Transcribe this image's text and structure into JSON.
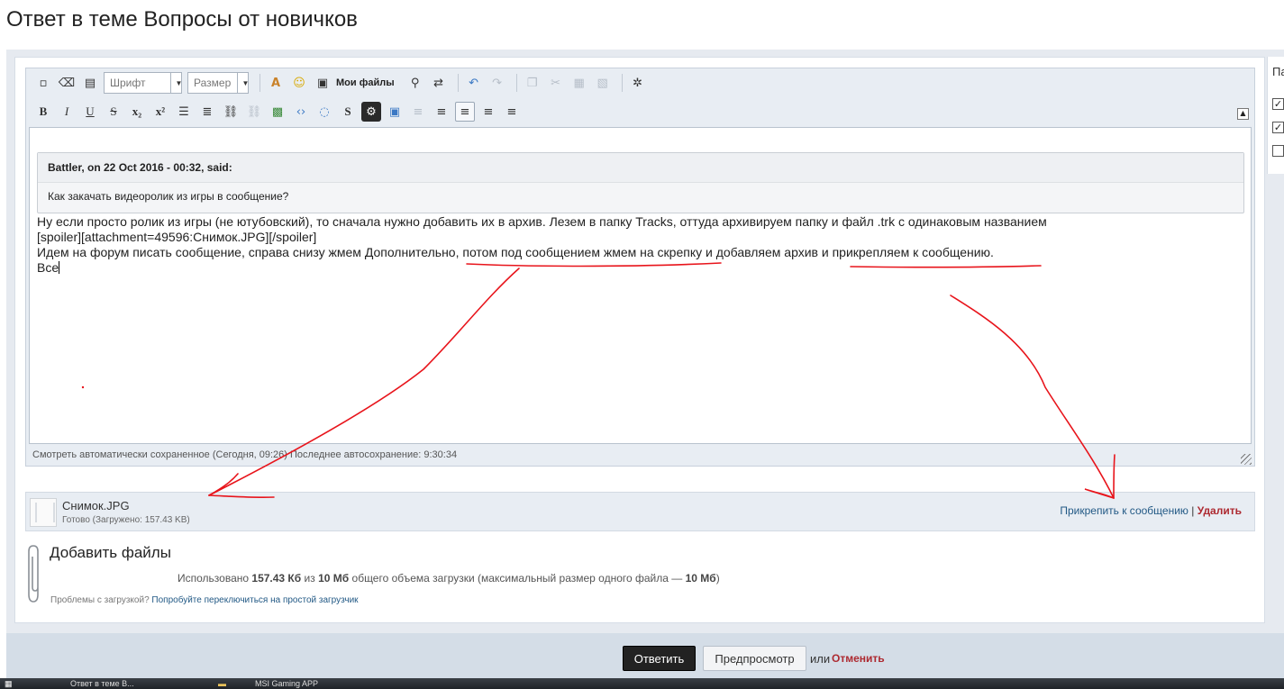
{
  "page": {
    "title": "Ответ в теме Вопросы от новичков"
  },
  "sidebar": {
    "title": "Па",
    "checkboxes": [
      true,
      true,
      false
    ]
  },
  "toolbar": {
    "font_placeholder": "Шрифт",
    "size_placeholder": "Размер",
    "my_files_label": "Мои файлы",
    "bold": "B",
    "italic": "I",
    "underline": "U",
    "strike": "S",
    "subscript": "x₂",
    "superscript": "x²",
    "spoiler": "S"
  },
  "quote": {
    "header": "Battler, on 22 Oct 2016 - 00:32, said:",
    "body": "Как закачать видеоролик из игры в сообщение?"
  },
  "post": {
    "lines": [
      "Ну если просто ролик из игры (не ютубовский), то сначала нужно добавить их в архив. Лезем в папку Tracks, оттуда архивируем папку и файл .trk с одинаковым названием",
      "[spoiler][attachment=49596:Снимок.JPG][/spoiler]",
      "Идем на форум писать сообщение, справа снизу жмем Дополнительно, потом под сообщением жмем на скрепку и добавляем архив и прикрепляем к сообщению.",
      "Все"
    ]
  },
  "autosave": {
    "text": "Смотреть автоматически сохраненное (Сегодня, 09:26) Последнее автосохранение: 9:30:34"
  },
  "attachment": {
    "file_name": "Снимок.JPG",
    "status": "Готово (Загружено: 157.43 KB)",
    "attach_link": "Прикрепить к сообщению",
    "separator": "|",
    "delete_link": "Удалить"
  },
  "add_files": {
    "title": "Добавить файлы",
    "usage_prefix": "Использовано",
    "used": "157.43 Кб",
    "of": "из",
    "total": "10 Мб",
    "usage_mid": "общего объема загрузки (максимальный размер одного файла —",
    "max_file": "10 Мб",
    "usage_end": ")",
    "problems_text": "Проблемы с загрузкой?",
    "problems_link": "Попробуйте переключиться на простой загрузчик"
  },
  "actions": {
    "submit": "Ответить",
    "preview": "Предпросмотр",
    "or": "или",
    "cancel": "Отменить"
  },
  "taskbar": {
    "items": [
      "Ответ в теме В...",
      "MSI Gaming APP"
    ]
  },
  "colors": {
    "accent_link": "#225985",
    "danger": "#ad2930",
    "annotation": "#e8141b",
    "panel_bg": "#e6eaf0",
    "editor_bg": "#e8edf3"
  }
}
